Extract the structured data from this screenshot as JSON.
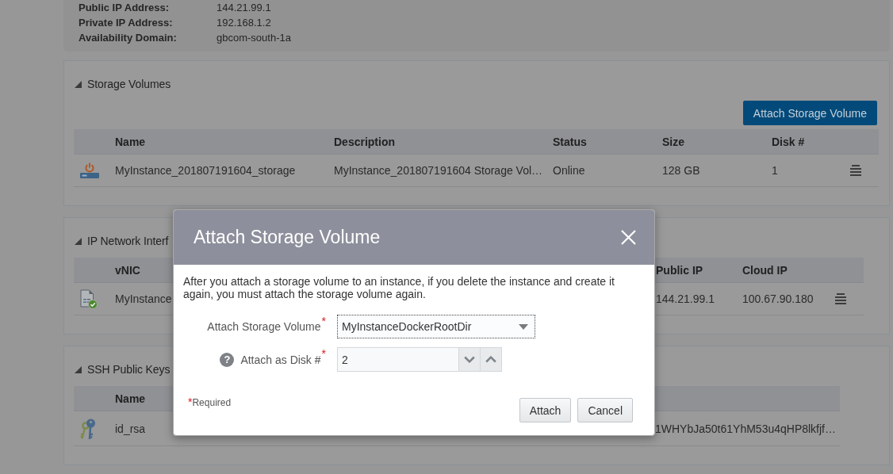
{
  "instance_details": [
    {
      "label": "Public IP Address:",
      "value": "144.21.99.1"
    },
    {
      "label": "Private IP Address:",
      "value": "192.168.1.2"
    },
    {
      "label": "Availability Domain:",
      "value": "gbcom-south-1a"
    }
  ],
  "sections": [
    {
      "kind": "storage",
      "title": "Storage Volumes",
      "expanded": true,
      "button": "Attach Storage Volume",
      "columns": [
        "Name",
        "Description",
        "Status",
        "Size",
        "Disk #"
      ],
      "rows": [
        {
          "cells": [
            "MyInstance_201807191604_storage",
            "MyInstance_201807191604 Storage Vol…",
            "Online",
            "128 GB",
            "1"
          ]
        }
      ]
    },
    {
      "kind": "network",
      "title": "IP Network Interf",
      "expanded": true,
      "columns": [
        "vNIC",
        "Public IP",
        "Cloud IP"
      ],
      "rows": [
        {
          "cells": [
            "MyInstance",
            "144.21.99.1",
            "100.67.90.180"
          ]
        }
      ]
    },
    {
      "kind": "ssh",
      "title": "SSH Public Keys",
      "expanded": true,
      "columns": [
        "Name"
      ],
      "rows": [
        {
          "cells": [
            "id_rsa",
            "1WHYbJa50t61YhM53u4qHP8lkfjf…"
          ]
        }
      ]
    }
  ],
  "dialog": {
    "title": "Attach Storage Volume",
    "description": "After you attach a storage volume to an instance, if you delete the instance and create it again, you must attach the storage volume again.",
    "fields": [
      {
        "kind": "select",
        "label": "Attach Storage Volume",
        "required_mark": "*",
        "value": "MyInstanceDockerRootDir"
      },
      {
        "kind": "number",
        "label": "Attach as Disk #",
        "help": "?",
        "required_mark": "*",
        "value": "2"
      }
    ],
    "required_note": {
      "mark": "*",
      "text": "Required"
    },
    "buttons": [
      "Attach",
      "Cancel"
    ]
  }
}
